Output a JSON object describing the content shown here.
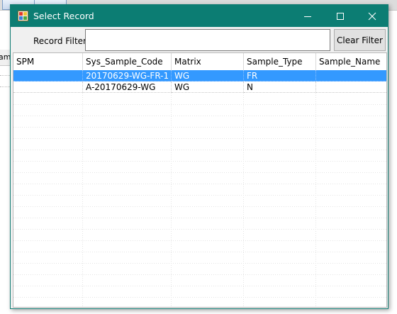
{
  "background_window": {
    "tab_fragment": "am"
  },
  "dialog": {
    "title": "Select Record",
    "controls": {
      "minimize": "minimize",
      "maximize": "maximize",
      "close": "close"
    },
    "filter": {
      "label": "Record Filter:",
      "value": "",
      "placeholder": ""
    },
    "clear_button_label": "Clear Filter",
    "grid": {
      "columns": [
        "SPM",
        "Sys_Sample_Code",
        "Matrix",
        "Sample_Type",
        "Sample_Name"
      ],
      "rows": [
        {
          "selected": true,
          "cells": [
            "",
            "20170629-WG-FR-1",
            "WG",
            "FR",
            ""
          ]
        },
        {
          "selected": false,
          "cells": [
            "",
            "A-20170629-WG",
            "WG",
            "N",
            ""
          ]
        }
      ]
    }
  },
  "colors": {
    "titlebar": "#0c7d73",
    "selection": "#3399ff"
  }
}
